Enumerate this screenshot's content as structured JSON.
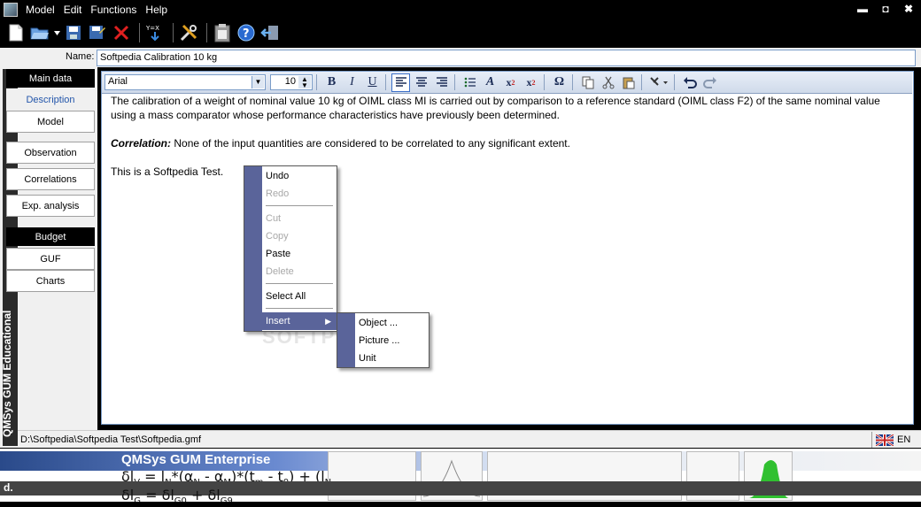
{
  "menubar": {
    "items": [
      "Model",
      "Edit",
      "Functions",
      "Help"
    ],
    "controls": [
      "▬",
      "◘",
      "✖"
    ]
  },
  "toolbar": {
    "icons": [
      "new-document-icon",
      "open-folder-icon",
      "dropdown-arrow-icon",
      "save-icon",
      "save-as-icon",
      "delete-icon",
      "formula-icon",
      "tools-icon",
      "clipboard-icon",
      "help-icon",
      "exit-icon"
    ]
  },
  "name_field": {
    "label": "Name:",
    "value": "Softpedia Calibration 10 kg"
  },
  "sidebar": {
    "vertical_label": "QMSys GUM Educational",
    "main_header": "Main data",
    "main_items": [
      "Description",
      "Model",
      "Observation",
      "Correlations",
      "Exp. analysis"
    ],
    "budget_header": "Budget",
    "budget_items": [
      "GUF",
      "Charts"
    ]
  },
  "format_bar": {
    "font": "Arial",
    "size": "10",
    "bold": "B",
    "italic": "I",
    "underline": "U",
    "omega": "Ω"
  },
  "document": {
    "paragraph1": "The calibration of a weight of nominal value 10 kg of OIML class MI is carried out by comparison to a reference standard (OIML class F2) of the same nominal value using a mass comparator whose performance characteristics have previously been determined.",
    "correlation_label": "Correlation:",
    "correlation_text": " None of the input quantities are considered to be correlated to any significant extent.",
    "paragraph3": "This is a Softpedia Test."
  },
  "context_menu": {
    "undo": "Undo",
    "redo": "Redo",
    "cut": "Cut",
    "copy": "Copy",
    "paste": "Paste",
    "delete": "Delete",
    "select_all": "Select All",
    "insert": "Insert"
  },
  "submenu": {
    "object": "Object ...",
    "picture": "Picture ...",
    "unit": "Unit"
  },
  "watermark": "SOFTPEDIA",
  "status": {
    "path": "D:\\Softpedia\\Softpedia Test\\Softpedia.gmf",
    "language": "EN"
  },
  "banner": {
    "title": "QMSys GUM Enterprise",
    "formula1": "δl",
    "formula1_rest": " = l",
    "formula2": "δl",
    "shade_label": "d."
  },
  "colors": {
    "menu_gutter": "#5a649a",
    "accent_border": "#7a9cc8",
    "active_nav_text": "#2255aa"
  }
}
